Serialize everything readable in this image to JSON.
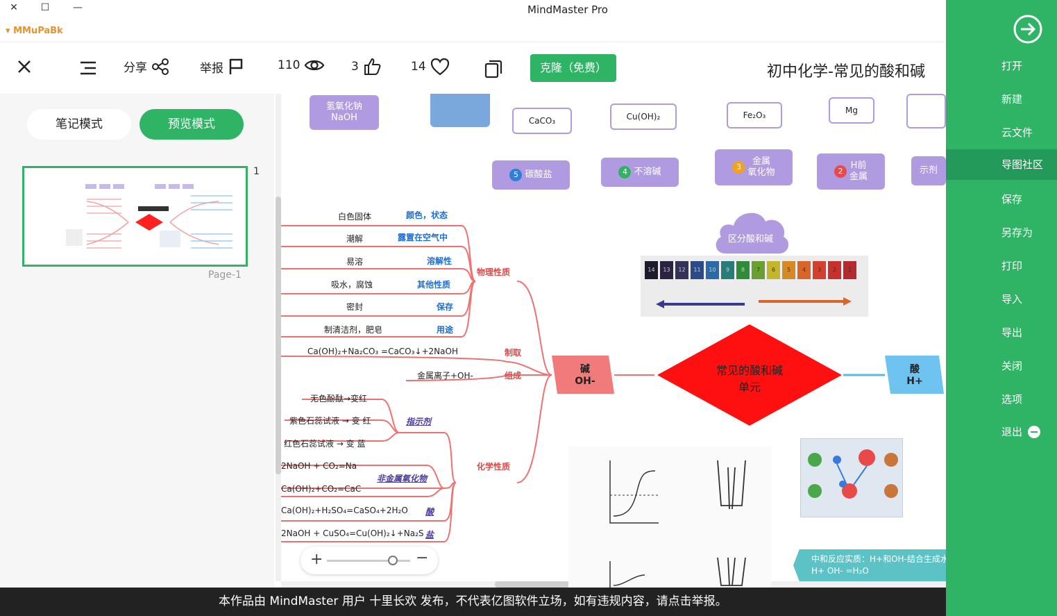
{
  "window": {
    "title": "MindMaster Pro",
    "app_tag": "MMuPaBk",
    "controls": {
      "minimize": "—",
      "maximize": "☐",
      "close": "✕"
    }
  },
  "sidebar": {
    "items": [
      {
        "label": "打开"
      },
      {
        "label": "新建"
      },
      {
        "label": "云文件"
      },
      {
        "label": "导图社区",
        "active": true
      },
      {
        "label": "保存"
      },
      {
        "label": "另存为"
      },
      {
        "label": "打印"
      },
      {
        "label": "导入"
      },
      {
        "label": "导出"
      },
      {
        "label": "关闭"
      },
      {
        "label": "选项"
      },
      {
        "label": "退出"
      }
    ]
  },
  "header": {
    "doc_title": "初中化学-常见的酸和碱",
    "clone_label": "克隆（免费）",
    "likes": "14",
    "thumbs": "3",
    "views": "110",
    "report_label": "举报",
    "share_label": "分享"
  },
  "left_panel": {
    "preview_mode": "预览模式",
    "note_mode": "笔记模式",
    "page_number": "1",
    "page_label": "Page-1"
  },
  "canvas": {
    "top_nodes": [
      "氢氧化钠\nNaOH",
      "CaCO₃",
      "Cu(OH)₂",
      "Fe₂O₃",
      "Mg"
    ],
    "cat_nodes": [
      {
        "num": "5",
        "label": "碳酸盐",
        "color": "#2f7fd8"
      },
      {
        "num": "4",
        "label": "不溶碱",
        "color": "#2fb364"
      },
      {
        "num": "3",
        "label": "金属\n氧化物",
        "color": "#f2a31b"
      },
      {
        "num": "2",
        "label": "H前\n金属",
        "color": "#e84a4a"
      },
      {
        "num": "",
        "label": "示剂",
        "color": ""
      }
    ],
    "cloud": "区分酸和碱",
    "ph_scale": [
      "1",
      "2",
      "3",
      "4",
      "5",
      "6",
      "7",
      "8",
      "9",
      "10",
      "11",
      "12",
      "13",
      "14"
    ],
    "center": "常见的酸和碱\n单元",
    "base_node": "碱\nOH-",
    "acid_node": "酸\nH+",
    "phys_branch": "物理性质",
    "phys_items": [
      {
        "key": "颜色，状态",
        "val": "白色固体"
      },
      {
        "key": "露置在空气中",
        "val": "潮解"
      },
      {
        "key": "溶解性",
        "val": "易溶"
      },
      {
        "key": "其他性质",
        "val": "吸水，腐蚀"
      },
      {
        "key": "保存",
        "val": "密封"
      },
      {
        "key": "用途",
        "val": "制清洁剂，肥皂"
      }
    ],
    "make_label": "制取",
    "make_val": "Ca(OH)₂+Na₂CO₃ =CaCO₃↓+2NaOH",
    "comp_label": "组成",
    "comp_val": "金属离子+OH-",
    "chem_branch": "化学性质",
    "indicator_label": "指示剂",
    "indicator_items": [
      "无色酚酞→变红",
      "紫色石蕊试液 → 变 红",
      "红色石蕊试液 → 变 蓝"
    ],
    "nonmetal_label": "非金属氧化物",
    "nonmetal_items": [
      "2NaOH + CO₂=Na",
      "Ca(OH)₂+CO₂=CaC"
    ],
    "acid_item": "Ca(OH)₂+H₂SO₄=CaSO₄+2H₂O",
    "acid_key": "酸",
    "salt_item": "2NaOH + CuSO₄=Cu(OH)₂↓+Na₂S",
    "salt_key": "盐",
    "neutral_text": "中和反应实质：H+和OH-结合生成水\nH+ OH- =H₂O"
  },
  "footer": {
    "notice": "本作品由 MindMaster 用户 十里长欢 发布，不代表亿图软件立场，如有违规内容，请点击举报。"
  }
}
